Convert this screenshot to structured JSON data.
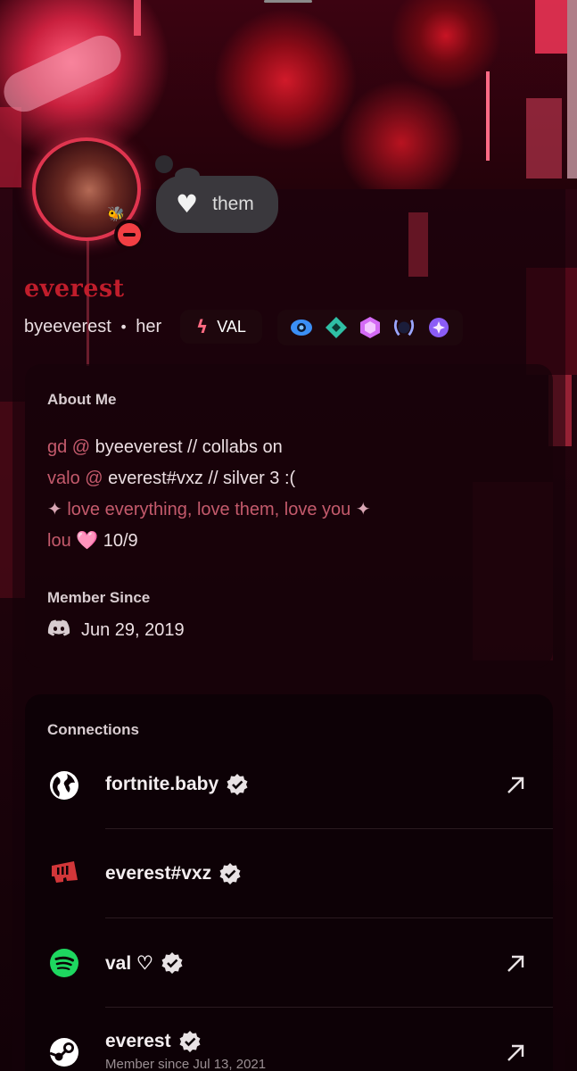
{
  "profile": {
    "display_name": "everest",
    "username": "byeeverest",
    "separator": "•",
    "pronouns": "her",
    "custom_status": {
      "emoji": "heart-icon",
      "text": "them"
    },
    "status": "do-not-disturb",
    "tag": {
      "icon": "valorant-bolt-icon",
      "label": "VAL"
    },
    "badges": [
      "hypesquad-icon",
      "nitro-gem-icon",
      "server-boost-icon",
      "laurel-badge-icon",
      "quest-badge-icon"
    ]
  },
  "about": {
    "heading": "About Me",
    "lines": {
      "l1_a": "gd @",
      "l1_b": " byeeverest // collabs on",
      "l2_a": "valo @",
      "l2_b": " everest#vxz // silver 3 :(",
      "l3_s1": "✦",
      "l3_txt": " love everything, love them, love you ",
      "l3_s2": "✦",
      "l4_a": "lou ",
      "l4_heart": "🩷",
      "l4_b": " 10/9"
    }
  },
  "member_since": {
    "heading": "Member Since",
    "date": "Jun 29, 2019"
  },
  "connections": {
    "heading": "Connections",
    "items": [
      {
        "icon": "globe-icon",
        "name": "fortnite.baby",
        "verified": true,
        "external": true
      },
      {
        "icon": "riot-games-icon",
        "name": "everest#vxz",
        "verified": true,
        "external": false
      },
      {
        "icon": "spotify-icon",
        "name": "val ♡",
        "verified": true,
        "external": true
      },
      {
        "icon": "steam-icon",
        "name": "everest",
        "verified": true,
        "external": true,
        "subtitle": "Member since Jul 13, 2021"
      }
    ]
  },
  "colors": {
    "accent_red": "#c01d2b",
    "dnd_red": "#f23f43",
    "spotify_green": "#1ed760",
    "riot_red": "#d13639"
  }
}
